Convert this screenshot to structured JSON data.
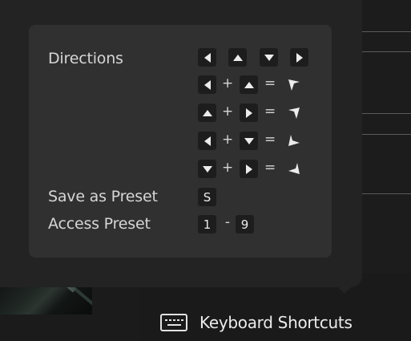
{
  "shortcuts": {
    "directions_label": "Directions",
    "save_preset_label": "Save as Preset",
    "save_preset_key": "S",
    "access_preset_label": "Access Preset",
    "access_preset_from": "1",
    "access_preset_sep": "-",
    "access_preset_to": "9",
    "plus": "+",
    "equals": "="
  },
  "footer": {
    "keyboard_shortcuts_label": "Keyboard Shortcuts"
  },
  "icons": {
    "arrow_left": "arrow-left-icon",
    "arrow_up": "arrow-up-icon",
    "arrow_down": "arrow-down-icon",
    "arrow_right": "arrow-right-icon",
    "diag_up_left": "diagonal-up-left-icon",
    "diag_up_right": "diagonal-up-right-icon",
    "diag_down_left": "diagonal-down-left-icon",
    "diag_down_right": "diagonal-down-right-icon",
    "keyboard": "keyboard-icon"
  }
}
